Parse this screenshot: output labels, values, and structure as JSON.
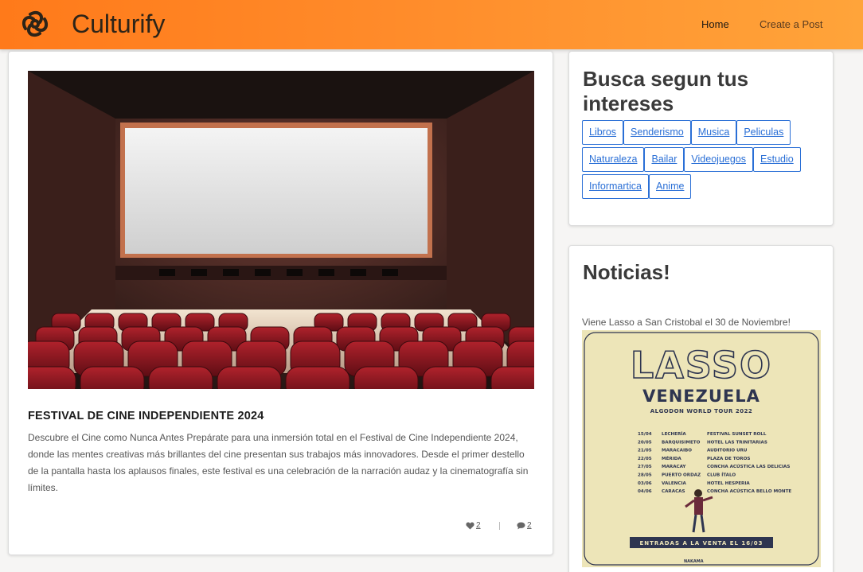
{
  "brand": {
    "name": "Culturify",
    "logo_icon": "knot-logo-icon"
  },
  "nav": {
    "home": "Home",
    "create_post": "Create a Post"
  },
  "post": {
    "image_icon": "cinema-theater-image",
    "title": "FESTIVAL DE CINE INDEPENDIENTE 2024",
    "body": "Descubre el Cine como Nunca Antes Prepárate para una inmersión total en el Festival de Cine Independiente 2024, donde las mentes creativas más brillantes del cine presentan sus trabajos más innovadores. Desde el primer destello de la pantalla hasta los aplausos finales, este festival es una celebración de la narración audaz y la cinematografía sin límites.",
    "likes": "2",
    "comments": "2"
  },
  "interests": {
    "title": "Busca segun tus intereses",
    "rows": [
      [
        "Libros",
        "Senderismo",
        "Musica",
        "Peliculas"
      ],
      [
        "Naturaleza",
        "Bailar",
        "Videojuegos",
        "Estudio"
      ],
      [
        "Informartica",
        "Anime"
      ]
    ]
  },
  "news": {
    "title": "Noticias!",
    "headline": "Viene Lasso a San Cristobal el 30 de Noviembre!",
    "poster": {
      "artist": "LASSO",
      "country": "VENEZUELA",
      "tour": "ALGODON WORLD TOUR 2022",
      "dates": [
        [
          "15/04",
          "LECHERÍA",
          "FESTIVAL SUNSET ROLL"
        ],
        [
          "20/05",
          "BARQUISIMETO",
          "HOTEL LAS TRINITARIAS"
        ],
        [
          "21/05",
          "MARACAIBO",
          "AUDITORIO URU"
        ],
        [
          "22/05",
          "MÉRIDA",
          "PLAZA DE TOROS"
        ],
        [
          "27/05",
          "MARACAY",
          "CONCHA ACÚSTICA LAS DELICIAS"
        ],
        [
          "28/05",
          "PUERTO ORDAZ",
          "CLUB ÍTALO"
        ],
        [
          "03/06",
          "VALENCIA",
          "HOTEL HESPERIA"
        ],
        [
          "04/06",
          "CARACAS",
          "CONCHA ACÚSTICA BELLO MONTE"
        ]
      ],
      "cta": "ENTRADAS A LA VENTA EL 16/03",
      "footer": "NAKAMA"
    }
  },
  "colors": {
    "nav_gradient_start": "#ff7a1a",
    "nav_gradient_end": "#ffa43a",
    "tag_blue": "#2a6fd6"
  }
}
